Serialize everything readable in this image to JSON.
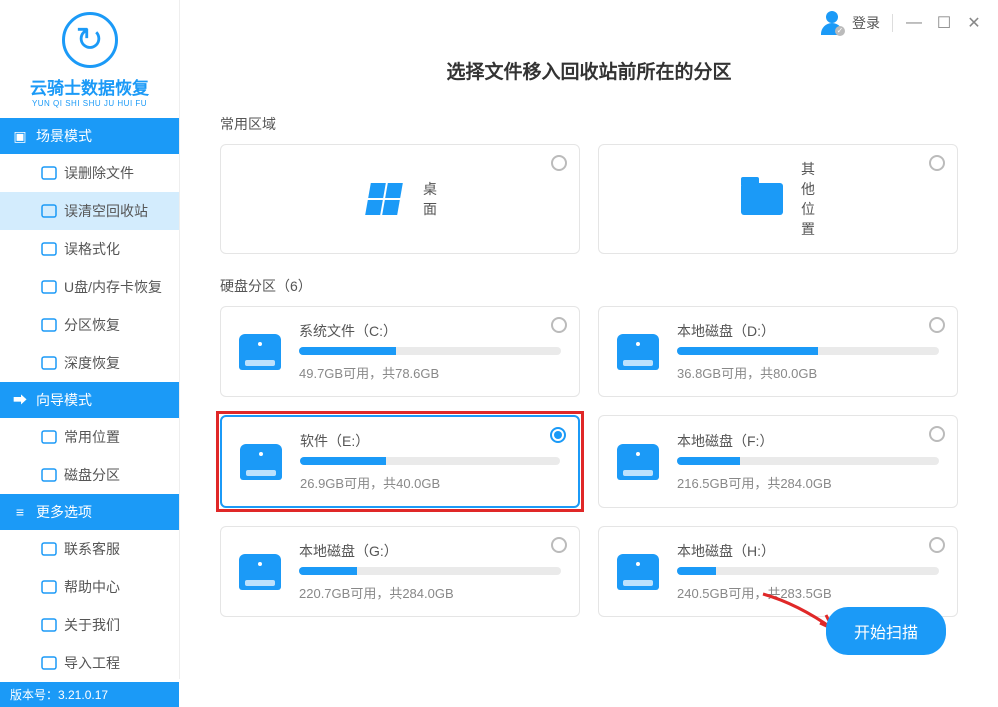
{
  "app": {
    "name": "云骑士数据恢复",
    "pinyin": "YUN QI SHI SHU JU HUI FU",
    "version_label": "版本号：3.21.0.17"
  },
  "top": {
    "login": "登录"
  },
  "sidebar": {
    "sections": [
      {
        "title": "场景模式",
        "items": [
          {
            "label": "误删除文件",
            "icon": "file-delete"
          },
          {
            "label": "误清空回收站",
            "icon": "recycle-bin",
            "active": true
          },
          {
            "label": "误格式化",
            "icon": "format"
          },
          {
            "label": "U盘/内存卡恢复",
            "icon": "usb"
          },
          {
            "label": "分区恢复",
            "icon": "partition"
          },
          {
            "label": "深度恢复",
            "icon": "deep"
          }
        ]
      },
      {
        "title": "向导模式",
        "items": [
          {
            "label": "常用位置",
            "icon": "location"
          },
          {
            "label": "磁盘分区",
            "icon": "disk-part"
          }
        ]
      },
      {
        "title": "更多选项",
        "items": [
          {
            "label": "联系客服",
            "icon": "support"
          },
          {
            "label": "帮助中心",
            "icon": "help"
          },
          {
            "label": "关于我们",
            "icon": "about"
          },
          {
            "label": "导入工程",
            "icon": "import"
          }
        ]
      }
    ]
  },
  "main": {
    "title": "选择文件移入回收站前所在的分区",
    "common_label": "常用区域",
    "common": [
      {
        "label": "桌面",
        "icon": "desktop"
      },
      {
        "label": "其他位置",
        "icon": "folder"
      }
    ],
    "partition_label": "硬盘分区（6）",
    "partitions": [
      {
        "name": "系统文件（C:）",
        "usage": "49.7GB可用，共78.6GB",
        "fill": 37,
        "selected": false
      },
      {
        "name": "本地磁盘（D:）",
        "usage": "36.8GB可用，共80.0GB",
        "fill": 54,
        "selected": false
      },
      {
        "name": "软件（E:）",
        "usage": "26.9GB可用，共40.0GB",
        "fill": 33,
        "selected": true,
        "highlight": true
      },
      {
        "name": "本地磁盘（F:）",
        "usage": "216.5GB可用，共284.0GB",
        "fill": 24,
        "selected": false
      },
      {
        "name": "本地磁盘（G:）",
        "usage": "220.7GB可用，共284.0GB",
        "fill": 22,
        "selected": false
      },
      {
        "name": "本地磁盘（H:）",
        "usage": "240.5GB可用，共283.5GB",
        "fill": 15,
        "selected": false
      }
    ],
    "start_button": "开始扫描"
  }
}
